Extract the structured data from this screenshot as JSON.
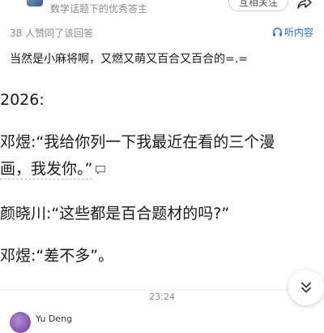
{
  "header": {
    "subtitle": "数学话题下的优秀答主",
    "follow_label": "互相关注"
  },
  "meta": {
    "votes_text": "38 人赞同了该回答",
    "listen_label": "听内容"
  },
  "answer": {
    "intro": "当然是小麻将啊，又燃又萌又百合又百合的=.=",
    "year": "2026:",
    "line1_speaker": "邓煜",
    "line1_text_a": ":“我给你列一下我最近在看的三个漫",
    "line1_text_b": "画，我发你。”",
    "line2": "颜晓川:“这些都是百合题材的吗?”",
    "line3": "邓煜:“差不多”。"
  },
  "footer": {
    "time": "23:24",
    "commenter_name": "Yu Deng"
  },
  "icons": {
    "share": "share-icon",
    "headphone": "headphone-icon",
    "comment": "comment-icon",
    "expand": "double-chevron-down-icon"
  },
  "colors": {
    "accent": "#2b6de5",
    "muted": "#8a8a8a"
  }
}
